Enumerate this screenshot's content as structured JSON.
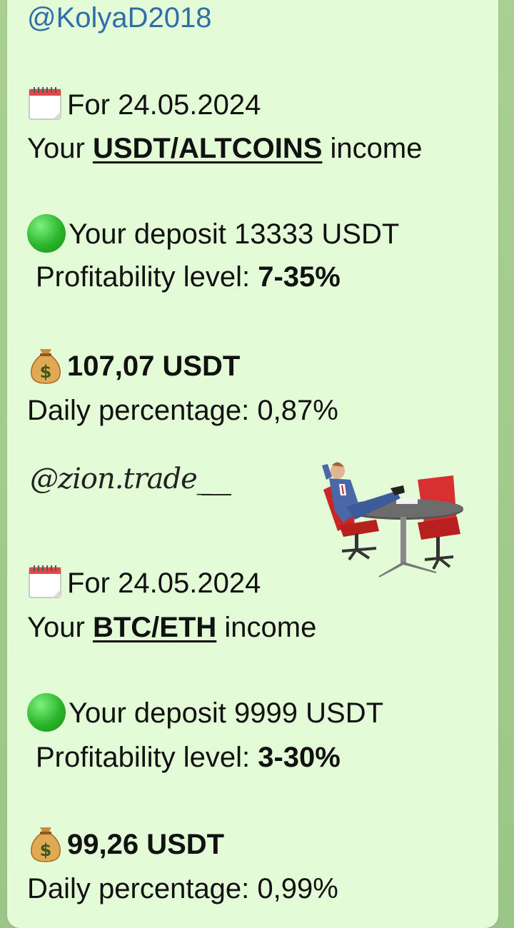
{
  "sender": "@KolyaD2018",
  "blocks": [
    {
      "date_line": "For 24.05.2024",
      "income_prefix": "Your ",
      "income_pair": "USDT/ALTCOINS",
      "income_suffix": " income",
      "deposit": "Your deposit 13333 USDT",
      "profit_label": "Profitability level: ",
      "profit_value": "7-35%",
      "amount": "107,07 USDT",
      "daily": "Daily percentage: 0,87%"
    },
    {
      "date_line": "For 24.05.2024",
      "income_prefix": "Your ",
      "income_pair": "BTC/ETH",
      "income_suffix": " income",
      "deposit": "Your deposit 9999 USDT",
      "profit_label": "Profitability level: ",
      "profit_value": "3-30%",
      "amount": "99,26 USDT",
      "daily": "Daily percentage: 0,99%"
    }
  ],
  "watermark": "@zion.trade_",
  "icons": {
    "calendar": "calendar-icon",
    "status": "green-circle-icon",
    "money": "money-bag-icon",
    "sticker": "relaxing-businessman-sticker"
  },
  "colors": {
    "bubble": "#e3fbd6",
    "mention": "#2f6ea9",
    "status_green": "#2bb52b"
  }
}
